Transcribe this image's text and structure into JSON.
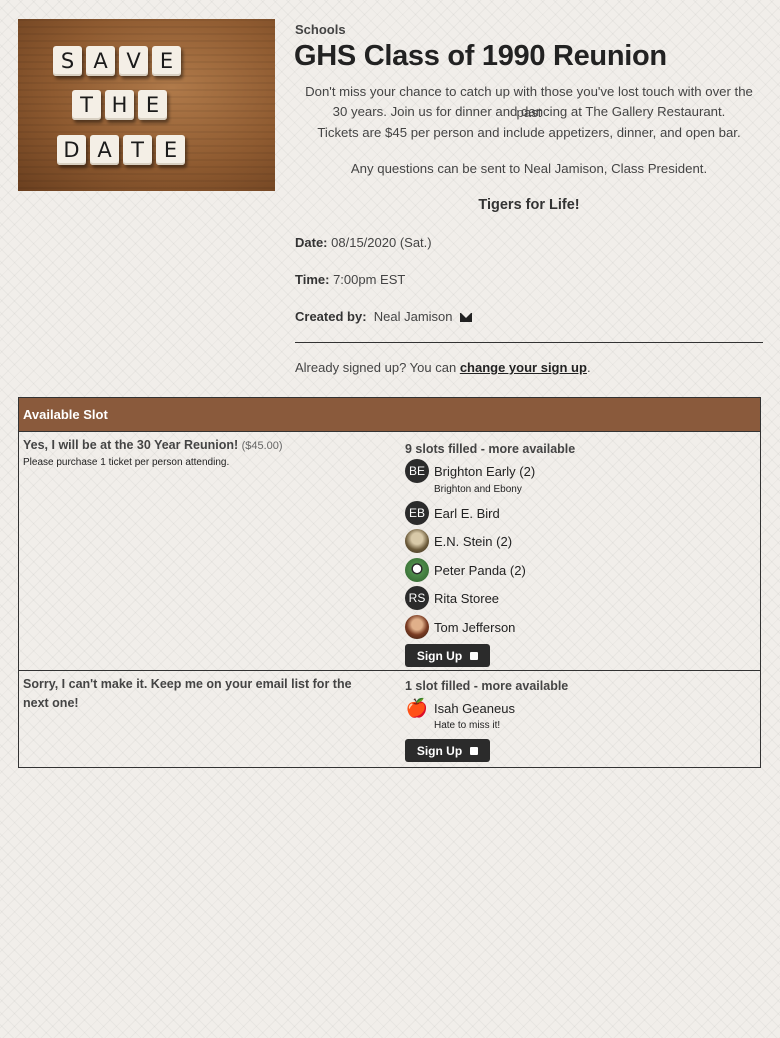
{
  "hero": {
    "tiles": [
      [
        "S",
        "A",
        "V",
        "E"
      ],
      [
        "T",
        "H",
        "E"
      ],
      [
        "D",
        "A",
        "T",
        "E"
      ]
    ]
  },
  "header": {
    "category": "Schools",
    "title": "GHS Class of 1990 Reunion",
    "desc_line1": "Don't miss your chance to catch up with those you've lost touch with over the past",
    "desc_line2": "30 years.  Join us for dinner and dancing at The Gallery Restaurant.",
    "desc_line3": "Tickets are $45 per person and include appetizers, dinner, and open bar.",
    "questions": "Any questions can be sent to Neal Jamison, Class President.",
    "motto": "Tigers for Life!",
    "date_label": "Date:",
    "date_value": "08/15/2020 (Sat.)",
    "time_label": "Time:",
    "time_value": "7:00pm EST",
    "created_label": "Created by:",
    "created_value": "Neal Jamison",
    "already_text": "Already signed up? You can ",
    "already_link": "change your sign up",
    "already_end": "."
  },
  "table": {
    "header": "Available Slot",
    "slots": [
      {
        "title": "Yes, I will be at the 30 Year Reunion!",
        "price": "($45.00)",
        "note": "Please purchase 1 ticket per person attending.",
        "filled": "9 slots filled - more available",
        "people": [
          {
            "avatar": "BE",
            "name": "Brighton Early (2)",
            "sub": "Brighton and Ebony"
          },
          {
            "avatar": "EB",
            "name": "Earl E. Bird"
          },
          {
            "avatar": "",
            "name": "E.N. Stein (2)"
          },
          {
            "avatar": "",
            "name": "Peter Panda (2)"
          },
          {
            "avatar": "RS",
            "name": "Rita Storee"
          },
          {
            "avatar": "",
            "name": "Tom Jefferson"
          }
        ],
        "button": "Sign Up"
      },
      {
        "title_line1": "Sorry, I can't make it. Keep me on your email list for the",
        "title_line2": "next one!",
        "filled": "1 slot filled - more available",
        "people": [
          {
            "avatar": "🍎",
            "name": "Isah Geaneus",
            "sub": "Hate to miss it!"
          }
        ],
        "button": "Sign Up"
      }
    ]
  }
}
